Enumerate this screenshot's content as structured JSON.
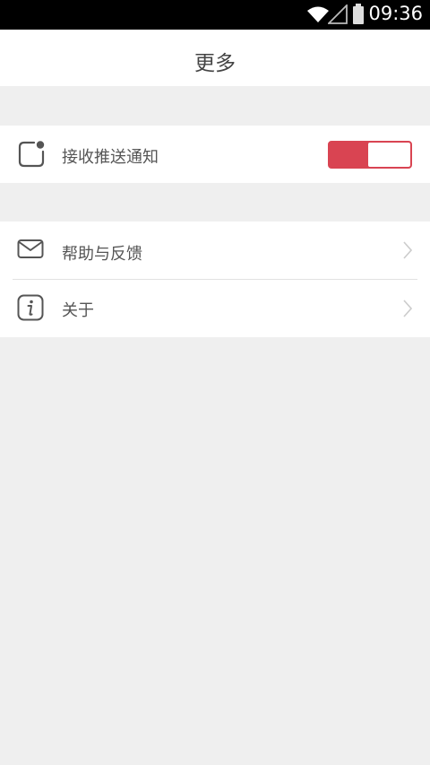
{
  "status_bar": {
    "time": "09:36",
    "icons": [
      "wifi-icon",
      "signal-icon",
      "battery-icon"
    ]
  },
  "header": {
    "title": "更多"
  },
  "settings": {
    "push": {
      "label": "接收推送通知",
      "icon": "notification-icon",
      "toggle_on": true,
      "accent": "#d94452"
    },
    "items": [
      {
        "label": "帮助与反馈",
        "icon": "mail-icon"
      },
      {
        "label": "关于",
        "icon": "info-icon"
      }
    ]
  }
}
